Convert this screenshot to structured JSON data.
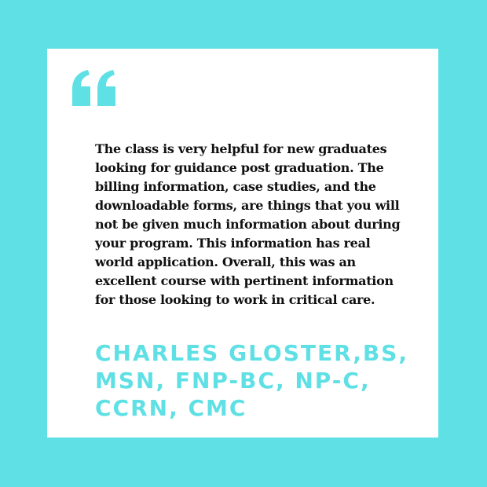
{
  "colors": {
    "background": "#5fe0e5",
    "card": "#ffffff",
    "accent": "#5fe0e5",
    "text": "#111111"
  },
  "quote_icon": "double-quote-icon",
  "testimonial": {
    "text": "The class is very helpful for new graduates\nlooking for guidance post graduation.  The\nbilling information, case studies, and the\ndownloadable forms, are things that you will\nnot be given much information about during\nyour program. This information has real\nworld application. Overall, this was an\nexcellent course with pertinent information\nfor those looking to work in critical care.",
    "author": "CHARLES GLOSTER,BS,\nMSN, FNP-BC, NP-C,\nCCRN, CMC"
  }
}
